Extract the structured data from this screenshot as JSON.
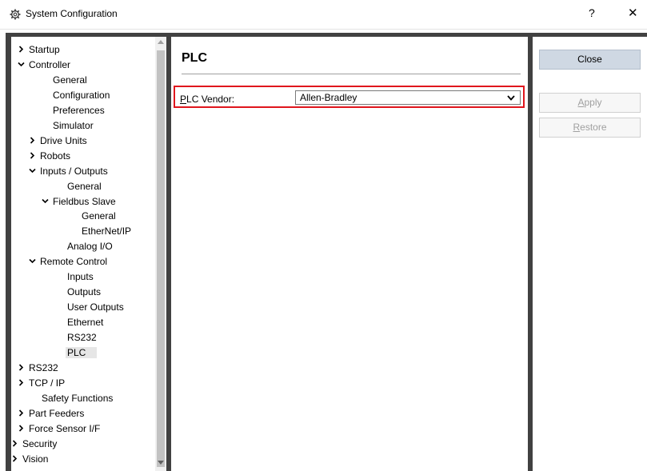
{
  "window": {
    "title": "System Configuration",
    "help_label": "?",
    "close_glyph": "✕",
    "icon": "gear-icon"
  },
  "tree": {
    "items": [
      {
        "label": "Startup",
        "expander": "collapsed"
      },
      {
        "label": "Controller",
        "expander": "expanded"
      },
      {
        "label": "General",
        "expander": "none"
      },
      {
        "label": "Configuration",
        "expander": "none"
      },
      {
        "label": "Preferences",
        "expander": "none"
      },
      {
        "label": "Simulator",
        "expander": "none"
      },
      {
        "label": "Drive Units",
        "expander": "collapsed"
      },
      {
        "label": "Robots",
        "expander": "collapsed"
      },
      {
        "label": "Inputs / Outputs",
        "expander": "expanded"
      },
      {
        "label": "General",
        "expander": "none"
      },
      {
        "label": "Fieldbus Slave",
        "expander": "expanded"
      },
      {
        "label": "General",
        "expander": "none"
      },
      {
        "label": "EtherNet/IP",
        "expander": "none"
      },
      {
        "label": "Analog I/O",
        "expander": "none"
      },
      {
        "label": "Remote Control",
        "expander": "expanded"
      },
      {
        "label": "Inputs",
        "expander": "none"
      },
      {
        "label": "Outputs",
        "expander": "none"
      },
      {
        "label": "User Outputs",
        "expander": "none"
      },
      {
        "label": "Ethernet",
        "expander": "none"
      },
      {
        "label": "RS232",
        "expander": "none"
      },
      {
        "label": "PLC",
        "expander": "none",
        "selected": true
      },
      {
        "label": "RS232",
        "expander": "collapsed"
      },
      {
        "label": "TCP / IP",
        "expander": "collapsed"
      },
      {
        "label": "Safety Functions",
        "expander": "none"
      },
      {
        "label": "Part Feeders",
        "expander": "collapsed"
      },
      {
        "label": "Force Sensor I/F",
        "expander": "collapsed"
      },
      {
        "label": "Security",
        "expander": "collapsed"
      },
      {
        "label": "Vision",
        "expander": "collapsed"
      }
    ]
  },
  "content": {
    "heading": "PLC",
    "vendor_label_mnemonic": "P",
    "vendor_label_rest": "LC Vendor:",
    "vendor_value": "Allen-Bradley"
  },
  "buttons": {
    "close": "Close",
    "apply_mnemonic": "A",
    "apply_rest": "pply",
    "restore_mnemonic": "R",
    "restore_rest": "estore"
  },
  "colors": {
    "highlight_border": "#e0161d",
    "close_button_bg": "#cfd8e3",
    "frame": "#414141"
  }
}
